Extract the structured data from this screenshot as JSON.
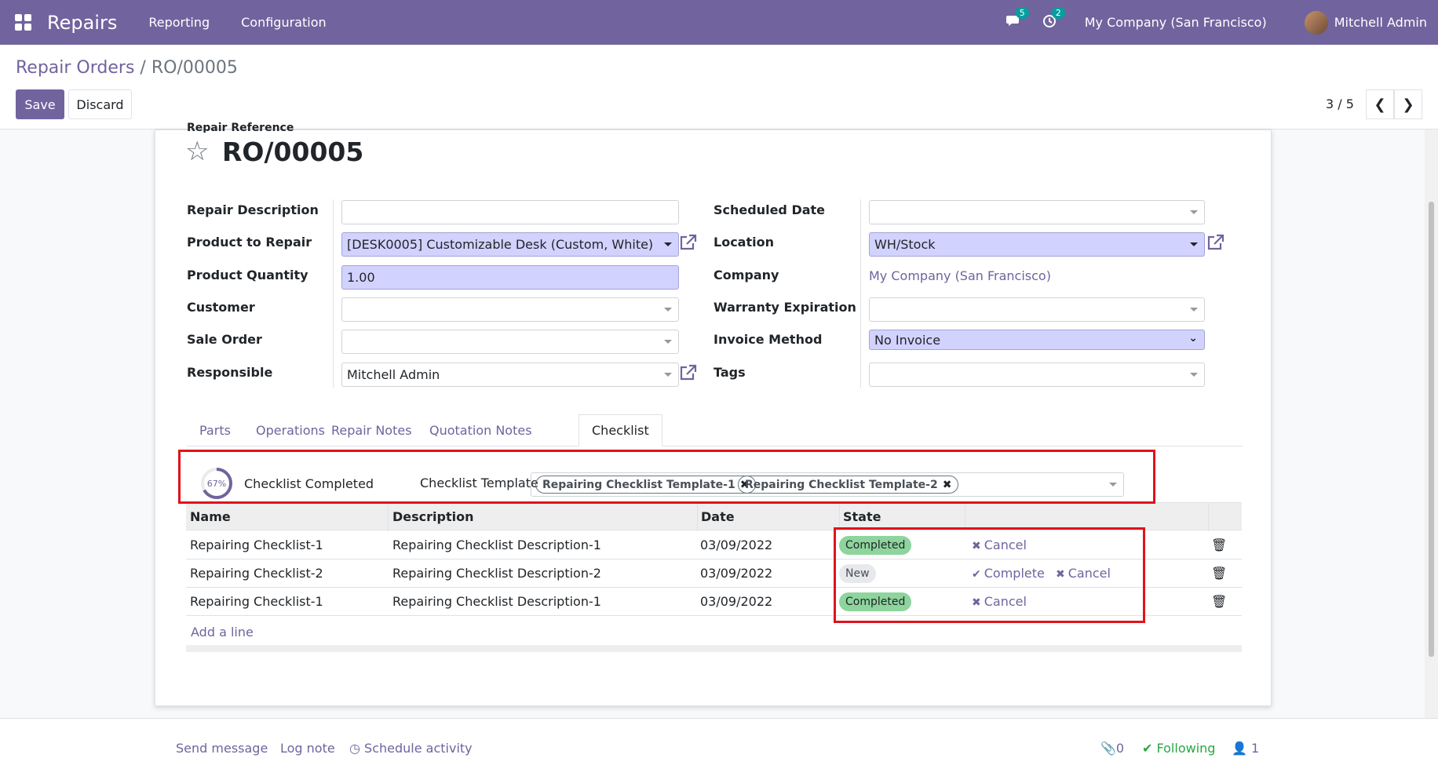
{
  "navbar": {
    "app_name": "Repairs",
    "menu": [
      "Reporting",
      "Configuration"
    ],
    "messages_count": "5",
    "activities_count": "2",
    "company": "My Company (San Francisco)",
    "user": "Mitchell Admin"
  },
  "breadcrumb": {
    "parent": "Repair Orders",
    "separator": "/",
    "current": "RO/00005"
  },
  "toolbar": {
    "save_label": "Save",
    "discard_label": "Discard",
    "pager": "3 / 5"
  },
  "form": {
    "title_label": "Repair Reference",
    "title": "RO/00005",
    "left_fields": [
      {
        "label": "Repair Description",
        "value": ""
      },
      {
        "label": "Product to Repair",
        "value": "[DESK0005] Customizable Desk (Custom, White)"
      },
      {
        "label": "Product Quantity",
        "value": "1.00"
      },
      {
        "label": "Customer",
        "value": ""
      },
      {
        "label": "Sale Order",
        "value": ""
      },
      {
        "label": "Responsible",
        "value": "Mitchell Admin"
      }
    ],
    "right_fields": [
      {
        "label": "Scheduled Date",
        "value": ""
      },
      {
        "label": "Location",
        "value": "WH/Stock"
      },
      {
        "label": "Company",
        "value": "My Company (San Francisco)"
      },
      {
        "label": "Warranty Expiration",
        "value": ""
      },
      {
        "label": "Invoice Method",
        "value": "No Invoice"
      },
      {
        "label": "Tags",
        "value": ""
      }
    ]
  },
  "tabs": [
    "Parts",
    "Operations",
    "Repair Notes",
    "Quotation Notes",
    "Checklist"
  ],
  "active_tab": "Checklist",
  "checklist": {
    "percent": "67%",
    "progress": 0.67,
    "completed_label": "Checklist Completed",
    "template_label": "Checklist Template",
    "templates": [
      "Repairing Checklist Template-1",
      "Repairing Checklist Template-2"
    ],
    "columns": [
      "Name",
      "Description",
      "Date",
      "State"
    ],
    "rows": [
      {
        "name": "Repairing Checklist-1",
        "description": "Repairing Checklist Description-1",
        "date": "03/09/2022",
        "state": "Completed",
        "complete_action": "",
        "cancel_action": "Cancel"
      },
      {
        "name": "Repairing Checklist-2",
        "description": "Repairing Checklist Description-2",
        "date": "03/09/2022",
        "state": "New",
        "complete_action": "Complete",
        "cancel_action": "Cancel"
      },
      {
        "name": "Repairing Checklist-1",
        "description": "Repairing Checklist Description-1",
        "date": "03/09/2022",
        "state": "Completed",
        "complete_action": "",
        "cancel_action": "Cancel"
      }
    ],
    "add_line": "Add a line"
  },
  "chatter": {
    "send_message": "Send message",
    "log_note": "Log note",
    "schedule_activity": "Schedule activity",
    "attachments": "0",
    "following": "Following",
    "followers": "1"
  },
  "colors": {
    "brand": "#71639e",
    "highlight": "#e0131b",
    "completed_badge": "#8ed49d"
  }
}
